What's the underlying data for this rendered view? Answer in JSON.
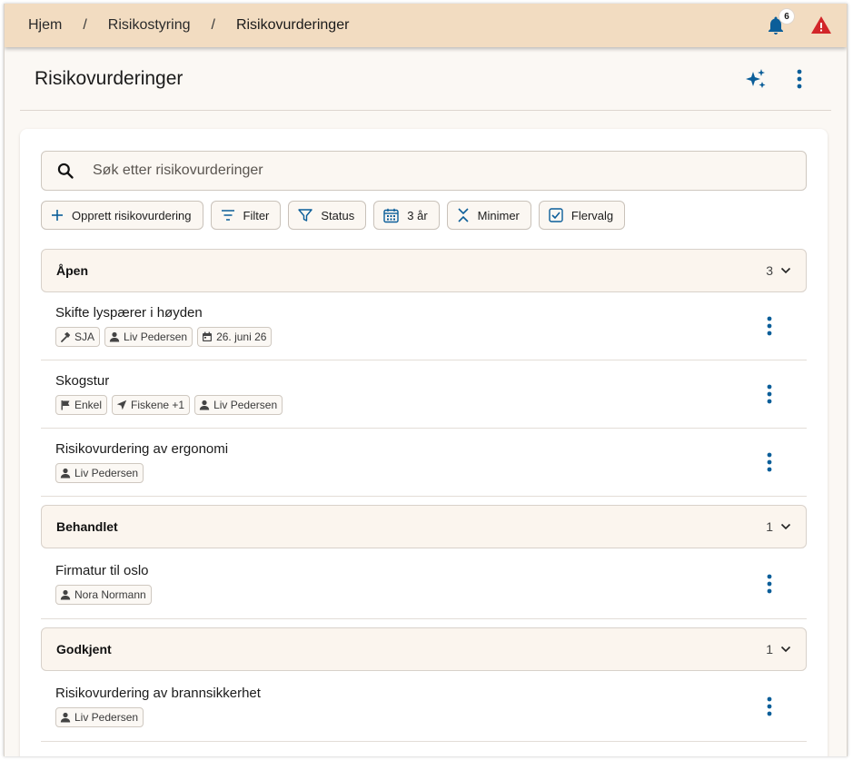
{
  "breadcrumb": {
    "items": [
      "Hjem",
      "Risikostyring",
      "Risikovurderinger"
    ],
    "separator": "/"
  },
  "topbar": {
    "notification_count": "6",
    "icons": {
      "bell": "bell-icon",
      "warning": "warning-icon"
    }
  },
  "header": {
    "title": "Risikovurderinger"
  },
  "search": {
    "placeholder": "Søk etter risikovurderinger"
  },
  "toolbar": {
    "create": "Opprett risikovurdering",
    "filter": "Filter",
    "status": "Status",
    "period": "3 år",
    "minimize": "Minimer",
    "multiselect": "Flervalg"
  },
  "groups": [
    {
      "title": "Åpen",
      "count": "3",
      "items": [
        {
          "title": "Skifte lyspærer i høyden",
          "chips": [
            {
              "icon": "hammer-icon",
              "text": "SJA"
            },
            {
              "icon": "person-icon",
              "text": "Liv Pedersen"
            },
            {
              "icon": "calendar-icon",
              "text": "26. juni 26"
            }
          ]
        },
        {
          "title": "Skogstur",
          "chips": [
            {
              "icon": "flag-icon",
              "text": "Enkel"
            },
            {
              "icon": "location-arrow-icon",
              "text": "Fiskene +1"
            },
            {
              "icon": "person-icon",
              "text": "Liv Pedersen"
            }
          ]
        },
        {
          "title": "Risikovurdering av ergonomi",
          "chips": [
            {
              "icon": "person-icon",
              "text": "Liv Pedersen"
            }
          ]
        }
      ]
    },
    {
      "title": "Behandlet",
      "count": "1",
      "items": [
        {
          "title": "Firmatur til oslo",
          "chips": [
            {
              "icon": "person-icon",
              "text": "Nora Normann"
            }
          ]
        }
      ]
    },
    {
      "title": "Godkjent",
      "count": "1",
      "items": [
        {
          "title": "Risikovurdering av brannsikkerhet",
          "chips": [
            {
              "icon": "person-icon",
              "text": "Liv Pedersen"
            }
          ]
        }
      ]
    }
  ],
  "colors": {
    "topbar_bg": "#f2dcc1",
    "accent_blue": "#0b5e99",
    "warning_red": "#d2262a",
    "page_bg": "#fbf8f4"
  }
}
